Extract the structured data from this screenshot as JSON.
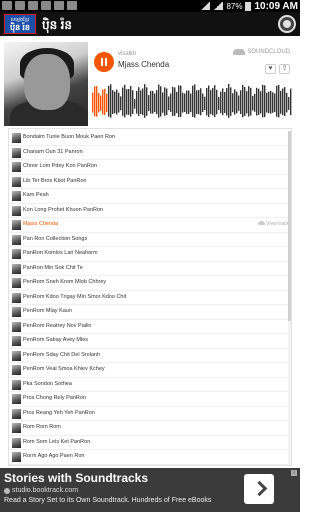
{
  "status": {
    "battery": "87%",
    "time": "10:09 AM"
  },
  "app": {
    "logo_top": "សម្លេងខ្មែរ",
    "logo_bottom": "ប៉ិន រ៉ន",
    "title": "ប៉ិន រ៉ន"
  },
  "player": {
    "user": "visalkh",
    "track": "Mjass Chenda",
    "brand": "SOUNDCLOUD",
    "like_icon": "♥",
    "share_icon": "⇪",
    "accent": "#f55500"
  },
  "tracks": [
    {
      "name": "Bondaim Tunle Buon Mouk Paen Ron"
    },
    {
      "name": "Chanam Oun 31 Panron"
    },
    {
      "name": "Chnor Lom Pdey Kon PanRon"
    },
    {
      "name": "Lib Ter Bros Kbot PanRon"
    },
    {
      "name": "Kam Peah"
    },
    {
      "name": "Kon Long Prohet Khuon PanRon"
    },
    {
      "name": "Mjass Chenda",
      "view_label": "View track"
    },
    {
      "name": "Pan Ron Collection Songs"
    },
    {
      "name": "PanRon Komlos Lan Neahorm"
    },
    {
      "name": "PanRon Min Sok Chit Te"
    },
    {
      "name": "PenRom Sneh Krom Mlob Chhrey"
    },
    {
      "name": "PenRom Kdoo Tngay Min Smor Kdoo Chit"
    },
    {
      "name": "PenRom Mlay Kaun"
    },
    {
      "name": "PenRom Reatrey Nov Pailin"
    },
    {
      "name": "PenRom Sabay Avey Mles"
    },
    {
      "name": "PenRom Sday Chit Del Srolanh"
    },
    {
      "name": "PenRom Veal Smoa Khiev Kchey"
    },
    {
      "name": "Pka Sondon Sothea"
    },
    {
      "name": "Pros Chong Rely PanRon"
    },
    {
      "name": "Pros Reang Yeh Yeh PanRon"
    },
    {
      "name": "Rom Rom Rom"
    },
    {
      "name": "Rom Som Leis Ket PanRon"
    },
    {
      "name": "Rorm Ago Ago Paen Ron"
    }
  ],
  "active_index": 6,
  "ad": {
    "title": "Stories with Soundtracks",
    "url": "studio.booktrack.com",
    "desc": "Read a Story Set to its Own Soundtrack. Hundreds of Free eBooks",
    "info": "i"
  }
}
